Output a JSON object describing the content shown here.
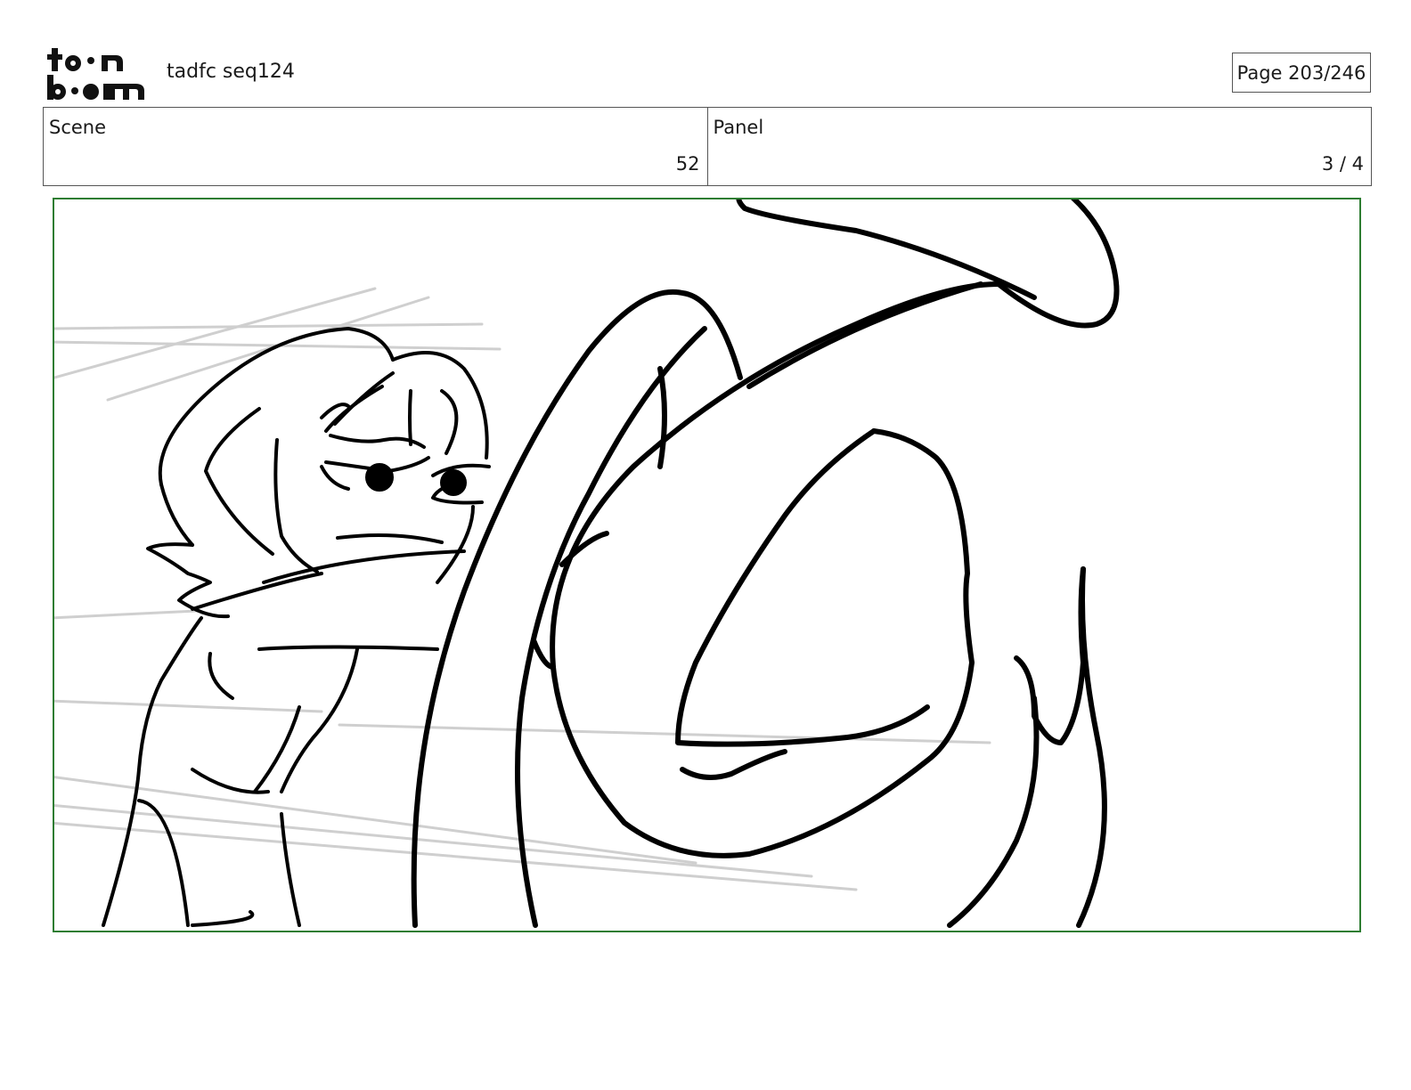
{
  "header": {
    "logo_icon": "toonboom-logo",
    "logo_text_top": "toon",
    "logo_text_bottom": "boom",
    "doc_title": "tadfc seq124",
    "page_label": "Page 203/246"
  },
  "info": {
    "scene_label": "Scene",
    "scene_value": "52",
    "panel_label": "Panel",
    "panel_value": "3 / 4"
  },
  "colors": {
    "frame_border": "#2e7d32",
    "ink": "#000000",
    "guide_lines": "#bdbdbd"
  }
}
